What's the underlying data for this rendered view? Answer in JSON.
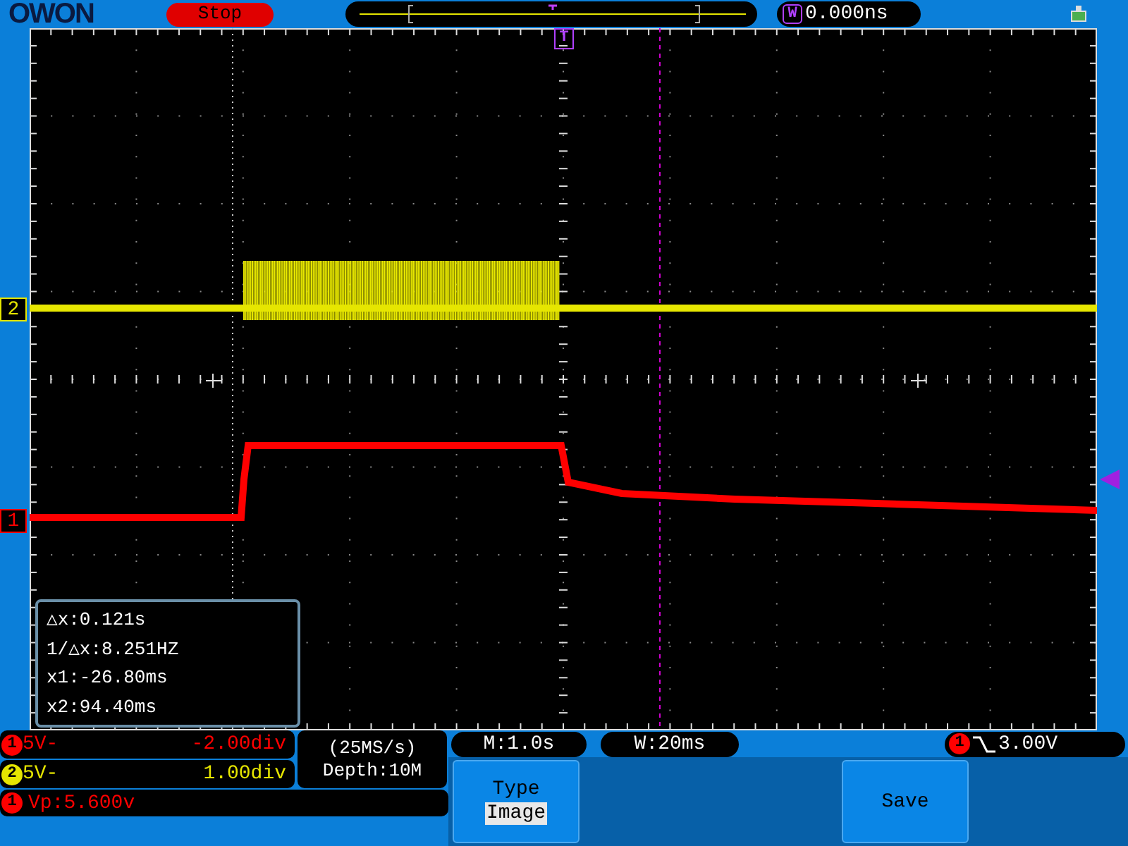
{
  "header": {
    "logo": "OWON",
    "run_state": "Stop",
    "trigger_time_label": "W",
    "trigger_time": "0.000ns"
  },
  "screen": {
    "trigger_marker": "T",
    "channel_markers": [
      {
        "label": "2",
        "color": "#e6e600"
      },
      {
        "label": "1",
        "color": "#ff0000"
      }
    ],
    "cursor_readout": [
      "△x:0.121s",
      "1/△x:8.251HZ",
      "x1:-26.80ms",
      "x2:94.40ms"
    ]
  },
  "channels": [
    {
      "badge": "1",
      "color": "#ff0000",
      "scale": "5V-",
      "offset": "-2.00div"
    },
    {
      "badge": "2",
      "color": "#e6e600",
      "scale": "5V-",
      "offset": "1.00div"
    }
  ],
  "acquisition": {
    "rate": "(25MS/s)",
    "depth": "Depth:10M"
  },
  "measurement": {
    "badge": "1",
    "color": "#ff0000",
    "text": "Vp:5.600v"
  },
  "timebase": "M:1.0s",
  "window": "W:20ms",
  "trigger": {
    "badge": "1",
    "color": "#ff0000",
    "value": "3.00V"
  },
  "menu": [
    {
      "kind": "option",
      "title": "Type",
      "value": "Image"
    },
    {
      "kind": "blank"
    },
    {
      "kind": "blank"
    },
    {
      "kind": "action",
      "title": "Save"
    },
    {
      "kind": "blank"
    }
  ]
}
